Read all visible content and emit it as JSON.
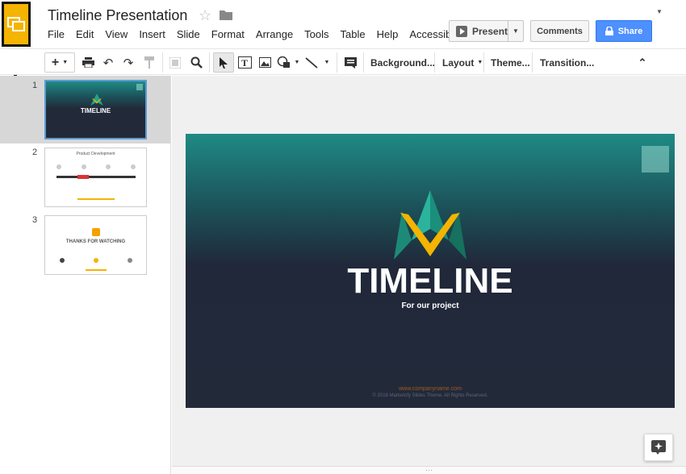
{
  "app": {
    "title": "Timeline Presentation",
    "logo_icon": "slides-logo-icon",
    "accent_color": "#f4b400"
  },
  "menu": [
    "File",
    "Edit",
    "View",
    "Insert",
    "Slide",
    "Format",
    "Arrange",
    "Tools",
    "Table",
    "Help",
    "Accessibility"
  ],
  "header_buttons": {
    "present": "Present",
    "comments": "Comments",
    "share": "Share"
  },
  "toolbar": {
    "background": "Background...",
    "layout": "Layout",
    "theme": "Theme...",
    "transition": "Transition..."
  },
  "filmstrip": {
    "slides": [
      {
        "number": "1",
        "title": "TIMELINE"
      },
      {
        "number": "2",
        "title": "Product Development"
      },
      {
        "number": "3",
        "title": "THANKS FOR WATCHING"
      }
    ]
  },
  "slide": {
    "title": "TIMELINE",
    "subtitle": "For our project",
    "url": "www.companyname.com",
    "copyright": "© 2016 Marketofy Slides Theme. All Rights Reserved."
  }
}
